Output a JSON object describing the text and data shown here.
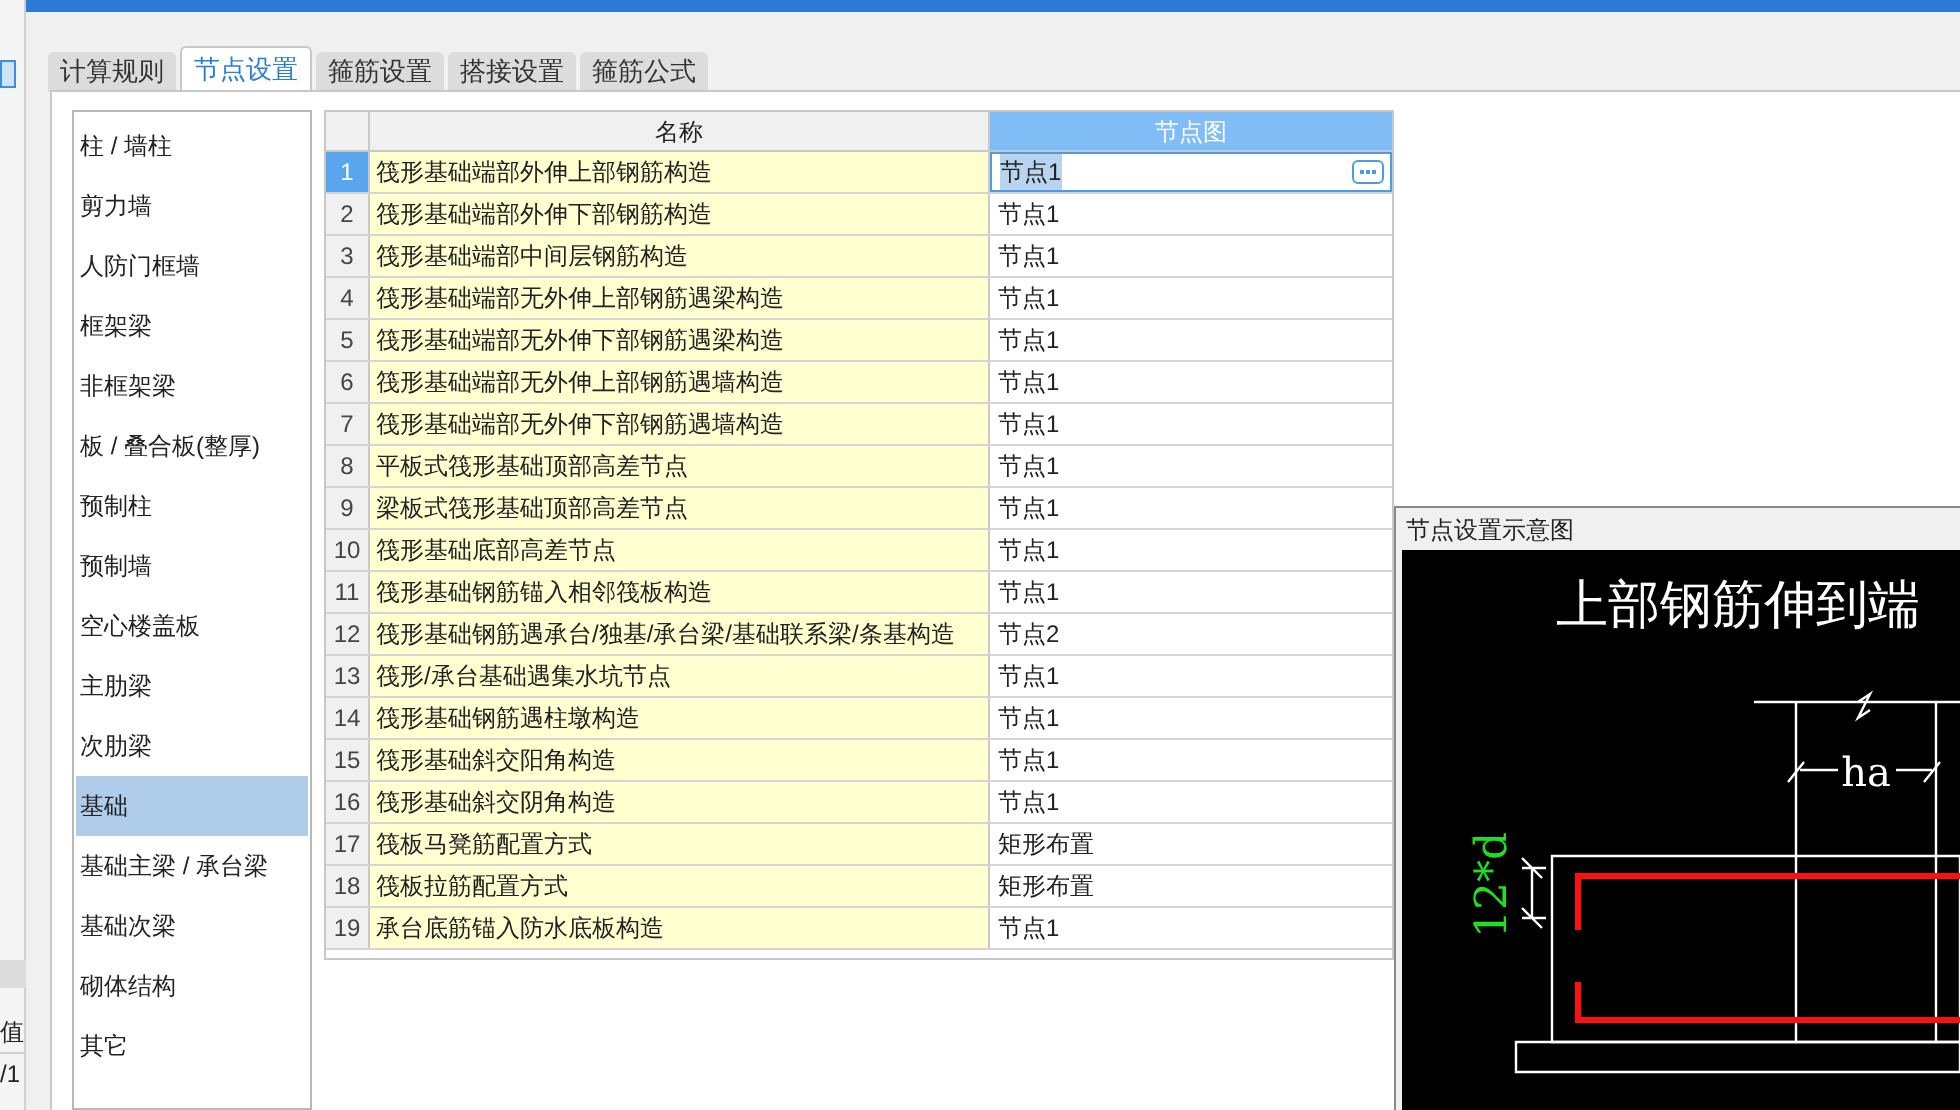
{
  "background_window": {
    "column_header": "值",
    "cell": "/1"
  },
  "tabs": [
    {
      "label": "计算规则",
      "selected": false
    },
    {
      "label": "节点设置",
      "selected": true
    },
    {
      "label": "箍筋设置",
      "selected": false
    },
    {
      "label": "搭接设置",
      "selected": false
    },
    {
      "label": "箍筋公式",
      "selected": false
    }
  ],
  "sidebar": {
    "items": [
      {
        "label": "柱 / 墙柱",
        "selected": false
      },
      {
        "label": "剪力墙",
        "selected": false
      },
      {
        "label": "人防门框墙",
        "selected": false
      },
      {
        "label": "框架梁",
        "selected": false
      },
      {
        "label": "非框架梁",
        "selected": false
      },
      {
        "label": "板 / 叠合板(整厚)",
        "selected": false
      },
      {
        "label": "预制柱",
        "selected": false
      },
      {
        "label": "预制墙",
        "selected": false
      },
      {
        "label": "空心楼盖板",
        "selected": false
      },
      {
        "label": "主肋梁",
        "selected": false
      },
      {
        "label": "次肋梁",
        "selected": false
      },
      {
        "label": "基础",
        "selected": true
      },
      {
        "label": "基础主梁 / 承台梁",
        "selected": false
      },
      {
        "label": "基础次梁",
        "selected": false
      },
      {
        "label": "砌体结构",
        "selected": false
      },
      {
        "label": "其它",
        "selected": false
      }
    ]
  },
  "table": {
    "columns": [
      "名称",
      "节点图"
    ],
    "rows": [
      {
        "index": "1",
        "name": "筏形基础端部外伸上部钢筋构造",
        "node": "节点1",
        "selected": true
      },
      {
        "index": "2",
        "name": "筏形基础端部外伸下部钢筋构造",
        "node": "节点1",
        "selected": false
      },
      {
        "index": "3",
        "name": "筏形基础端部中间层钢筋构造",
        "node": "节点1",
        "selected": false
      },
      {
        "index": "4",
        "name": "筏形基础端部无外伸上部钢筋遇梁构造",
        "node": "节点1",
        "selected": false
      },
      {
        "index": "5",
        "name": "筏形基础端部无外伸下部钢筋遇梁构造",
        "node": "节点1",
        "selected": false
      },
      {
        "index": "6",
        "name": "筏形基础端部无外伸上部钢筋遇墙构造",
        "node": "节点1",
        "selected": false
      },
      {
        "index": "7",
        "name": "筏形基础端部无外伸下部钢筋遇墙构造",
        "node": "节点1",
        "selected": false
      },
      {
        "index": "8",
        "name": "平板式筏形基础顶部高差节点",
        "node": "节点1",
        "selected": false
      },
      {
        "index": "9",
        "name": "梁板式筏形基础顶部高差节点",
        "node": "节点1",
        "selected": false
      },
      {
        "index": "10",
        "name": "筏形基础底部高差节点",
        "node": "节点1",
        "selected": false
      },
      {
        "index": "11",
        "name": "筏形基础钢筋锚入相邻筏板构造",
        "node": "节点1",
        "selected": false
      },
      {
        "index": "12",
        "name": "筏形基础钢筋遇承台/独基/承台梁/基础联系梁/条基构造",
        "node": "节点2",
        "selected": false
      },
      {
        "index": "13",
        "name": "筏形/承台基础遇集水坑节点",
        "node": "节点1",
        "selected": false
      },
      {
        "index": "14",
        "name": "筏形基础钢筋遇柱墩构造",
        "node": "节点1",
        "selected": false
      },
      {
        "index": "15",
        "name": "筏形基础斜交阳角构造",
        "node": "节点1",
        "selected": false
      },
      {
        "index": "16",
        "name": "筏形基础斜交阴角构造",
        "node": "节点1",
        "selected": false
      },
      {
        "index": "17",
        "name": "筏板马凳筋配置方式",
        "node": "矩形布置",
        "selected": false
      },
      {
        "index": "18",
        "name": "筏板拉筋配置方式",
        "node": "矩形布置",
        "selected": false
      },
      {
        "index": "19",
        "name": "承台底筋锚入防水底板构造",
        "node": "节点1",
        "selected": false
      }
    ]
  },
  "diagram": {
    "title": "节点设置示意图",
    "heading": "上部钢筋伸到端",
    "width_label": "ha",
    "anchor_label": "12*d"
  }
}
